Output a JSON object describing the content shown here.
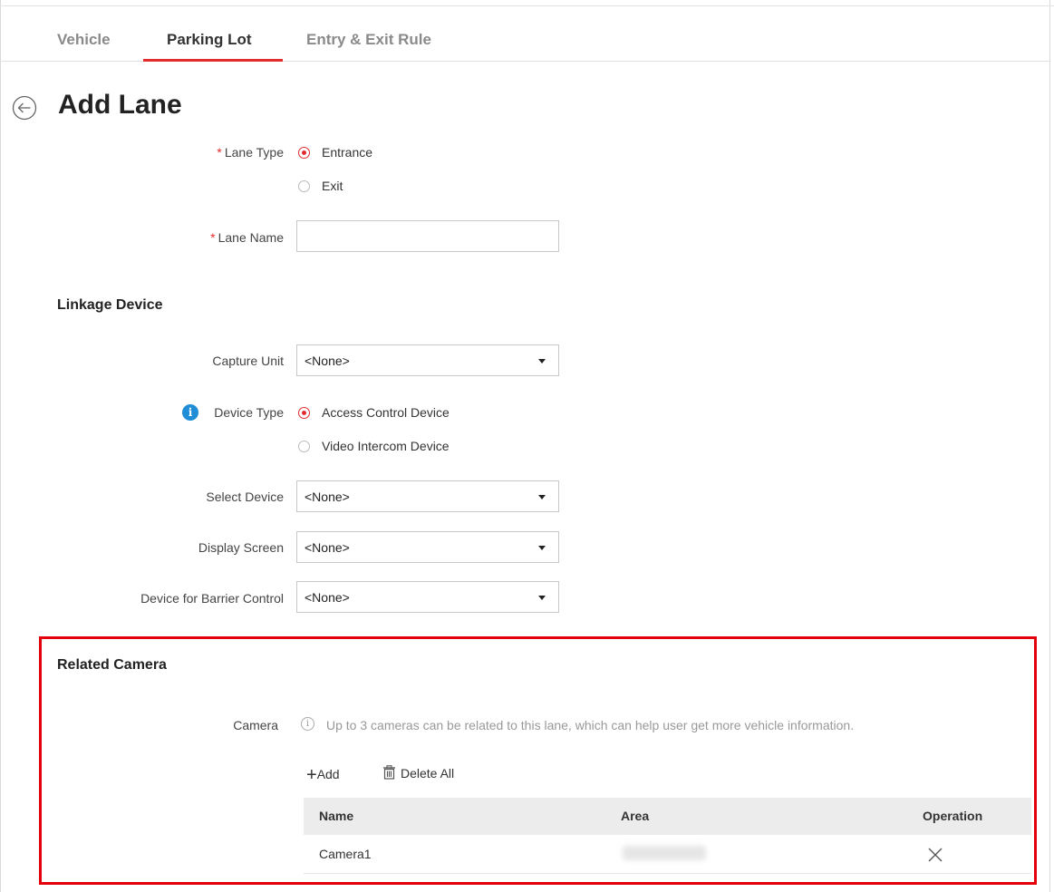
{
  "tabs": [
    {
      "label": "Vehicle",
      "active": false
    },
    {
      "label": "Parking Lot",
      "active": true
    },
    {
      "label": "Entry & Exit Rule",
      "active": false
    }
  ],
  "page": {
    "title": "Add Lane",
    "back_icon": "circle-arrow-left-icon"
  },
  "form": {
    "lane_type": {
      "label": "Lane Type",
      "required_mark": "*",
      "options": [
        "Entrance",
        "Exit"
      ],
      "selected": "Entrance"
    },
    "lane_name": {
      "label": "Lane Name",
      "required_mark": "*",
      "value": ""
    }
  },
  "linkage": {
    "title": "Linkage Device",
    "capture_unit": {
      "label": "Capture Unit",
      "value": "<None>"
    },
    "device_type": {
      "label": "Device Type",
      "info_icon": "i",
      "options": [
        "Access Control Device",
        "Video Intercom Device"
      ],
      "selected": "Access Control Device"
    },
    "select_device": {
      "label": "Select Device",
      "value": "<None>"
    },
    "display_screen": {
      "label": "Display Screen",
      "value": "<None>"
    },
    "barrier_control": {
      "label": "Device for Barrier Control",
      "value": "<None>"
    }
  },
  "related_camera": {
    "title": "Related Camera",
    "camera_label": "Camera",
    "hint_icon": "i",
    "hint": "Up to 3 cameras can be related to this lane, which can help user get more vehicle information.",
    "add_icon": "+",
    "add_label": "Add",
    "delete_all_label": "Delete All",
    "columns": [
      "Name",
      "Area",
      "Operation"
    ],
    "rows": [
      {
        "name": "Camera1",
        "area": ""
      }
    ]
  },
  "colors": {
    "accent": "#e22d2f",
    "highlight_box": "#e3000b",
    "info_blue": "#1f8ed6"
  }
}
